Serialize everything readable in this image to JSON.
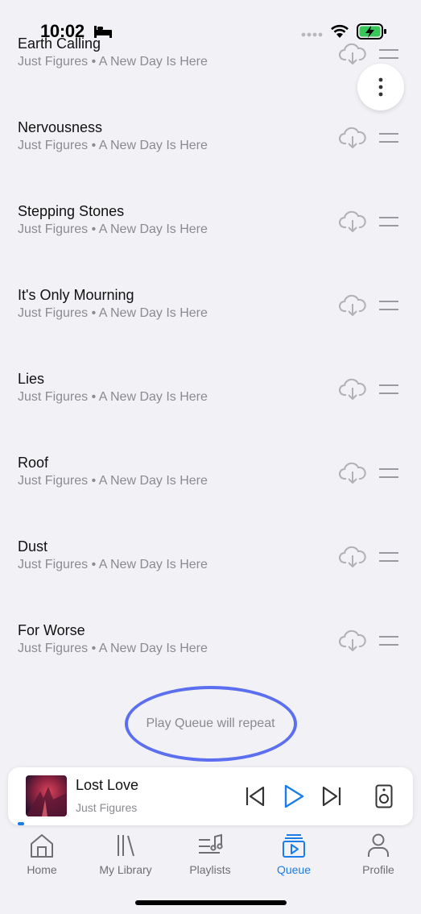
{
  "status_bar": {
    "time": "10:02"
  },
  "queue": {
    "tracks": [
      {
        "title": "Earth Calling",
        "subtitle": "Just Figures • A New Day Is Here"
      },
      {
        "title": "Nervousness",
        "subtitle": "Just Figures • A New Day Is Here"
      },
      {
        "title": "Stepping Stones",
        "subtitle": "Just Figures • A New Day Is Here"
      },
      {
        "title": "It's Only Mourning",
        "subtitle": "Just Figures • A New Day Is Here"
      },
      {
        "title": "Lies",
        "subtitle": "Just Figures • A New Day Is Here"
      },
      {
        "title": "Roof",
        "subtitle": "Just Figures • A New Day Is Here"
      },
      {
        "title": "Dust",
        "subtitle": "Just Figures • A New Day Is Here"
      },
      {
        "title": "For Worse",
        "subtitle": "Just Figures • A New Day Is Here"
      }
    ],
    "repeat_note": "Play Queue will repeat"
  },
  "now_playing": {
    "title": "Lost Love",
    "artist": "Just Figures"
  },
  "tabs": [
    {
      "label": "Home",
      "icon": "home-icon"
    },
    {
      "label": "My Library",
      "icon": "library-icon"
    },
    {
      "label": "Playlists",
      "icon": "playlists-icon"
    },
    {
      "label": "Queue",
      "icon": "queue-icon",
      "active": true
    },
    {
      "label": "Profile",
      "icon": "profile-icon"
    }
  ],
  "colors": {
    "accent": "#1c7ce8",
    "highlight": "#5b6ff0",
    "muted": "#8a8a90"
  }
}
